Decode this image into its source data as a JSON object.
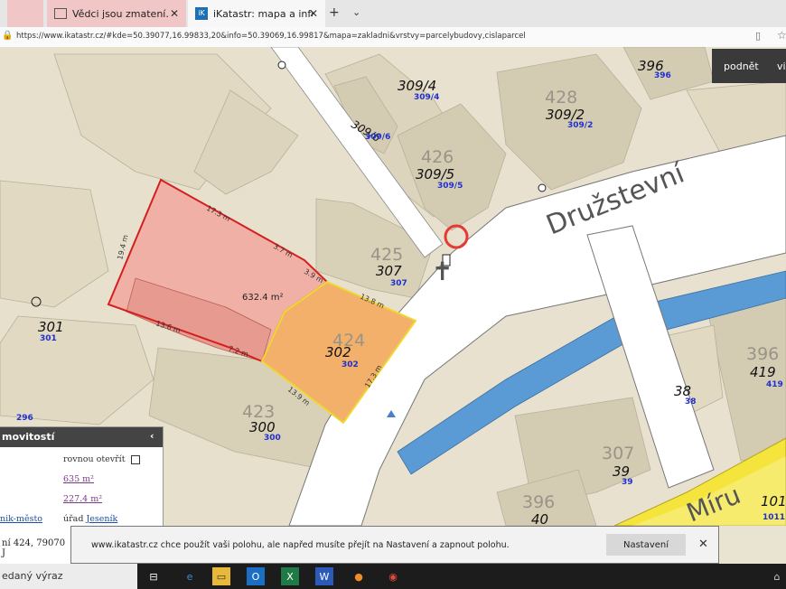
{
  "browser": {
    "tabs": [
      {
        "title": "Vědci jsou zmatení. Země se"
      },
      {
        "title": "iKatastr: mapa a informa"
      }
    ],
    "url": "https://www.ikatastr.cz/#kde=50.39077,16.99833,20&info=50.39069,16.99817&mapa=zakladni&vrstvy=parcelybudovy,cislaparcel"
  },
  "toolbar": {
    "podnet": "podnět",
    "vi": "vi"
  },
  "map": {
    "street_druzstevni": "Družstevní",
    "street_miru": "Míru",
    "area_label": "632.4 m²",
    "parcels": [
      {
        "num": "309/4",
        "sub": "309/4"
      },
      {
        "num": "396",
        "sub": "396"
      },
      {
        "num": "309/2",
        "sub": "309/2",
        "bld": "428"
      },
      {
        "num": "309/5",
        "sub": "309/5",
        "bld": "426"
      },
      {
        "num": "309/6",
        "sub": "309/6"
      },
      {
        "num": "307",
        "sub": "307",
        "bld": "425"
      },
      {
        "num": "302",
        "sub": "302",
        "bld": "424"
      },
      {
        "num": "301",
        "sub": "301"
      },
      {
        "num": "300",
        "sub": "300",
        "bld": "423"
      },
      {
        "num": "419",
        "sub": "419",
        "bld": "396"
      },
      {
        "num": "38",
        "sub": "38"
      },
      {
        "num": "39",
        "sub": "39",
        "bld": "307"
      },
      {
        "num": "40",
        "bld": "396"
      },
      {
        "num": "101",
        "sub": "1011"
      },
      {
        "num": "296",
        "sub": "296"
      }
    ],
    "dims": [
      "17.3 m",
      "19.4 m",
      "3.7 m",
      "3.9 m",
      "13.8 m",
      "13.6 m",
      "7.2 m",
      "13.9 m",
      "17.3 m"
    ]
  },
  "panel": {
    "title": "movitostí",
    "row1": "rovnou otevřít",
    "area1": "635 m²",
    "area2": "227.4 m²",
    "city": "nik-město",
    "office": "úřad",
    "office_link": "Jeseník",
    "address": "ní 424, 79070 J"
  },
  "notification": {
    "message": "www.ikatastr.cz chce použít vaši polohu, ale napřed musíte přejít na Nastavení a zapnout polohu.",
    "button": "Nastavení"
  },
  "taskbar": {
    "search": "edaný výraz"
  },
  "colors": {
    "street": "#ffffff",
    "water": "#5b9bd5",
    "yellow_road": "#f4e43c",
    "selected": "#f2b06a",
    "neighbor": "#f0a8a0"
  }
}
